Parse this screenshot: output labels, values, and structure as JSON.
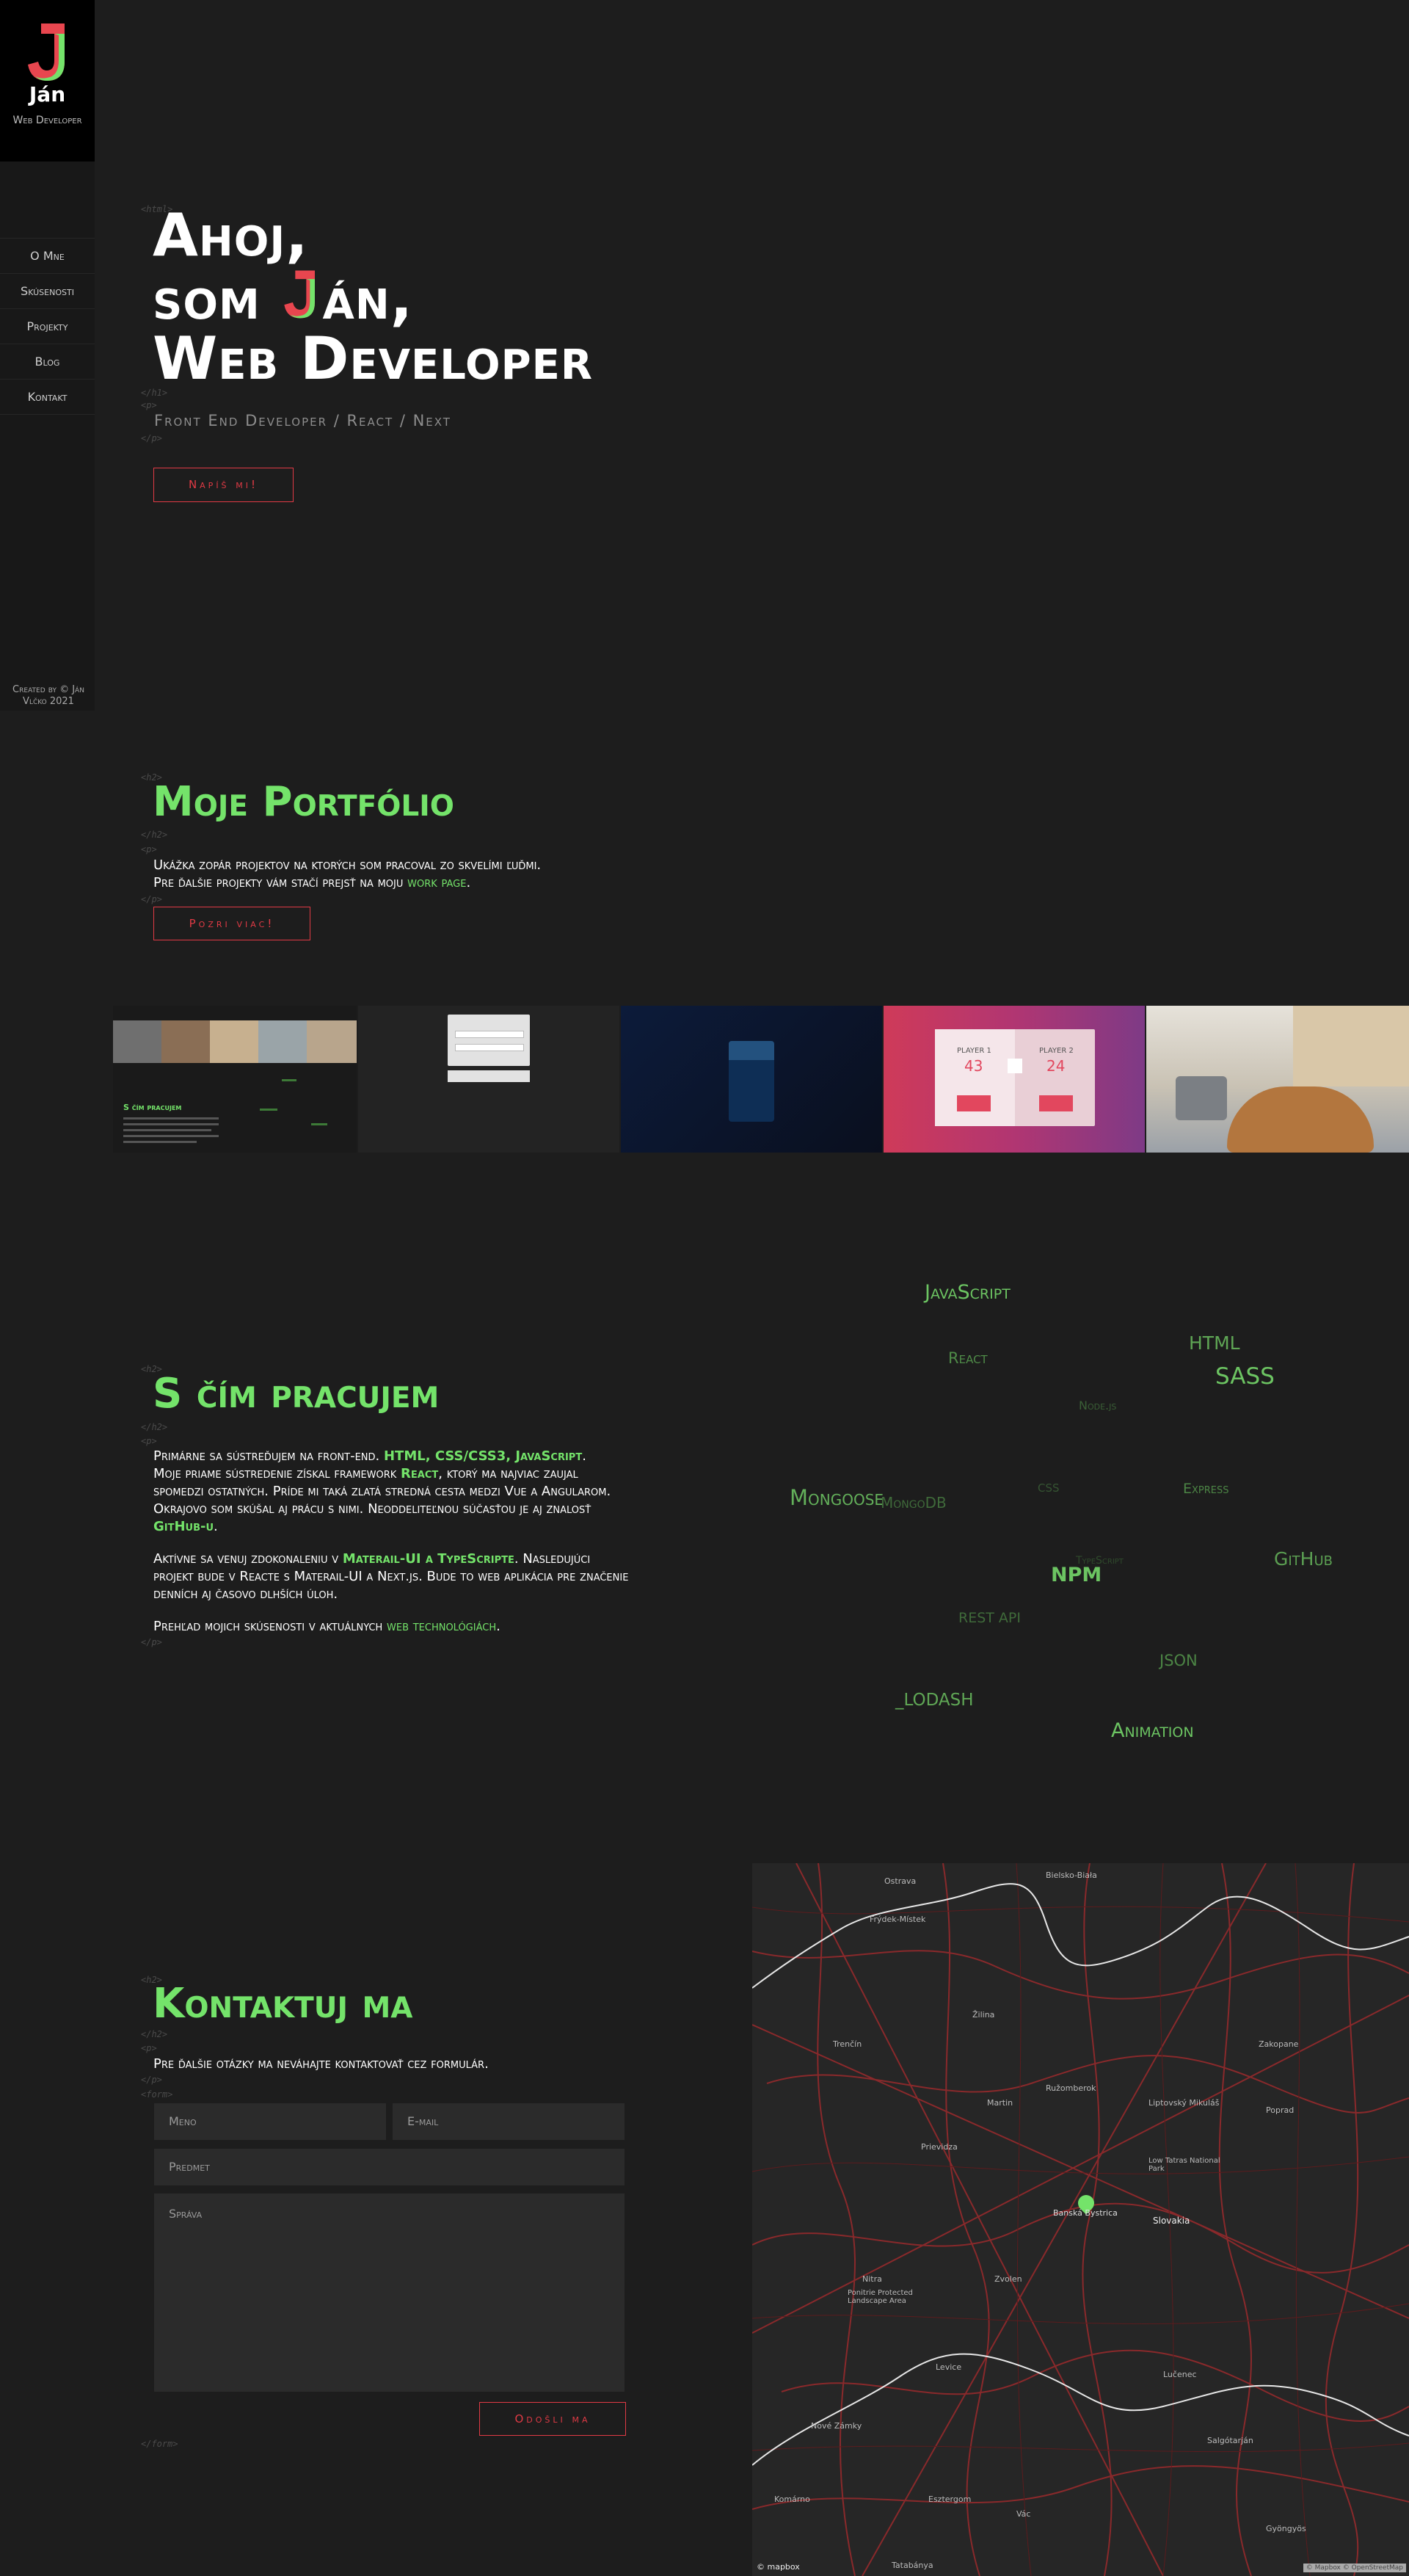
{
  "colors": {
    "accent": "#74e36a",
    "button": "#e03a45",
    "logo_red": "#e8464f",
    "logo_green": "#74e36a",
    "background": "#1d1d1d"
  },
  "sidebar": {
    "logo_letter": "J",
    "logo_name": "Ján",
    "logo_subtitle": "Web Developer",
    "nav": [
      {
        "label": "O Mne"
      },
      {
        "label": "Skúsenosti"
      },
      {
        "label": "Projekty"
      },
      {
        "label": "Blog"
      },
      {
        "label": "Kontakt"
      }
    ],
    "footer_line1": "Created by © Ján",
    "footer_line2": "Vlčko 2021"
  },
  "tags": {
    "html": "<html>",
    "h1_open": "<h1>",
    "h1_close": "</h1>",
    "h2_open": "<h2>",
    "h2_close": "</h2>",
    "p_open": "<p>",
    "p_close": "</p>",
    "form_open": "<form>",
    "form_close": "</form>"
  },
  "hero": {
    "line1": "Ahoj,",
    "line2_prefix": "som ",
    "line2_letter": "J",
    "line2_suffix": "án,",
    "line3": "Web Developer",
    "subtitle": "Front End Developer / React / Next",
    "button": "Napíš mi!"
  },
  "portfolio": {
    "title": "Moje Portfólio",
    "line1": "Ukážka zopár projektov na ktorých som pracoval zo skvelími ľuďmi.",
    "line2_prefix": "Pre ďalšie projekty vám stačí prejsť na moju ",
    "line2_link": "work page",
    "line2_suffix": ".",
    "button": "Pozri viac!",
    "thumb2_title": "S čím pracujem",
    "thumb4_player1": "PLAYER 1",
    "thumb4_player2": "PLAYER 2",
    "thumb4_score1": "43",
    "thumb4_score2": "24"
  },
  "skills": {
    "title": "S čím pracujem",
    "p1_a": "Primárne sa sústreďujem na front-end. ",
    "p1_b": "HTML, CSS/CSS3, JavaScript",
    "p1_c": ".",
    "p1_d": "Moje priame sústredenie získal framework ",
    "p1_e": "React",
    "p1_f": ", ktorý ma najviac zaujal spomedzi ostatných. Príde mi taká zlatá stredná cesta medzi Vue a Angularom. Okrajovo som skúšal aj prácu s nimi. Neoddeliteľnou súčasťou je aj znalosť ",
    "p1_g": "GitHub-u",
    "p1_h": ".",
    "p2_a": "Aktívne sa venuj zdokonaleniu v ",
    "p2_b": "Materail-UI a TypeScripte",
    "p2_c": ". Nasledujúci projekt bude v Reacte s Materail-UI a Next.js. Bude to web aplikácia pre značenie denních aj časovo dlhších úloh.",
    "p3_a": "Prehľad mojich skúsenosti v aktuálnych ",
    "p3_b": "web technológiách",
    "p3_c": ".",
    "cloud": [
      "JavaScript",
      "HTML",
      "React",
      "SASS",
      "Node.js",
      "Mongoose",
      "MongoDB",
      "CSS",
      "Express",
      "TypeScript",
      "GitHub",
      "NPM",
      "REST API",
      "JSON",
      "_LODASH",
      "Animation"
    ]
  },
  "contact": {
    "title": "Kontaktuj ma",
    "text": "Pre ďalšie otázky ma neváhajte kontaktovať cez formulár.",
    "name_placeholder": "Meno",
    "email_placeholder": "E-mail",
    "subject_placeholder": "Predmet",
    "message_placeholder": "Správa",
    "button": "Odošli ma"
  },
  "map": {
    "places": [
      "Ostrava",
      "Bielsko-Biała",
      "Frýdek-Místek",
      "Žilina",
      "Martin",
      "Poprad",
      "Banská Bystrica",
      "Slovakia",
      "Nitra",
      "Zvolen",
      "Trenčín",
      "Prievidza",
      "Ružomberok",
      "Liptovský Mikuláš",
      "Zakopane",
      "Low Tatras National Park",
      "Levice",
      "Lučenec",
      "Nové Zámky",
      "Komárno",
      "Esztergom",
      "Vác",
      "Salgótarján",
      "Gyöngyös",
      "Ponitrie Protected Landscape Area",
      "Tatabánya"
    ],
    "attribution": "© mapbox",
    "copyright": "© Mapbox © OpenStreetMap"
  }
}
